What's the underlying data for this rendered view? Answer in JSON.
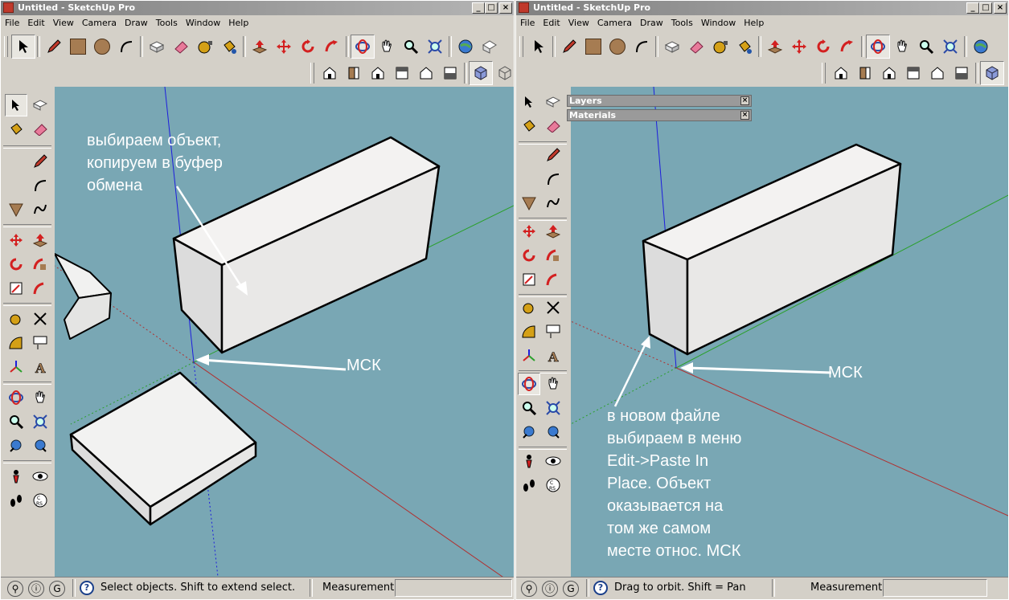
{
  "left_window": {
    "title": "Untitled - SketchUp Pro",
    "menu": [
      "File",
      "Edit",
      "View",
      "Camera",
      "Draw",
      "Tools",
      "Window",
      "Help"
    ],
    "annotation_top": "выбираем объект,\nкопируем в буфер\nобмена",
    "annotation_origin": "МСК",
    "status_hint": "Select objects. Shift to extend select.",
    "measurements_label": "Measurements"
  },
  "right_window": {
    "title": "Untitled - SketchUp Pro",
    "menu": [
      "File",
      "Edit",
      "View",
      "Camera",
      "Draw",
      "Tools",
      "Window",
      "Help"
    ],
    "trays": [
      "Layers",
      "Materials"
    ],
    "annotation_origin": "МСК",
    "annotation_bottom": "в новом файле\nвыбираем в меню\nEdit->Paste In\nPlace. Объект\nоказывается на\nтом же самом\nместе относ. МСК",
    "status_hint": "Drag to orbit.  Shift = Pan",
    "measurements_label": "Measurements"
  },
  "window_buttons": {
    "minimize": "_",
    "maximize": "□",
    "close": "×"
  },
  "status_icons": {
    "geo": "⚲",
    "credits": "ⓘ",
    "account": "G",
    "help": "?"
  },
  "colors": {
    "viewport": "#79a7b4",
    "red_axis": "#b03030",
    "green_axis": "#2aa02a",
    "blue_axis": "#1d1ddd",
    "face": "#eeedec",
    "titlebar": "#9a9a9a"
  },
  "icons": {
    "toolbar_main": [
      "select-icon",
      "pencil-icon",
      "rectangle-icon",
      "circle-icon",
      "arc-icon",
      "eraser-icon",
      "eraser-pink-icon",
      "tape-measure-icon",
      "paint-bucket-icon",
      "push-pull-icon",
      "move-icon",
      "rotate-icon",
      "follow-me-icon",
      "orbit-icon",
      "pan-icon",
      "zoom-icon",
      "zoom-extents-icon",
      "geolocation-icon",
      "warehouse-icon"
    ],
    "toolbar_views": [
      "iso-view-icon",
      "top-view-icon",
      "front-view-icon",
      "right-view-icon",
      "back-view-icon",
      "left-view-icon",
      "xray-cube-icon",
      "wireframe-cube-icon"
    ]
  }
}
